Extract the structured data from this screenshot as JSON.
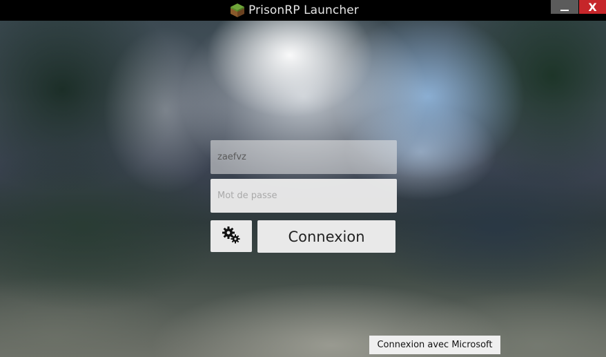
{
  "window": {
    "title": "PrisonRP Launcher",
    "app_icon": "grass-block-icon",
    "minimize_icon": "minimize-icon",
    "close_label": "X"
  },
  "login": {
    "username": {
      "value": "zaefvz",
      "placeholder": ""
    },
    "password": {
      "value": "",
      "placeholder": "Mot de passe"
    },
    "settings_icon": "gears-icon",
    "connect_label": "Connexion"
  },
  "microsoft": {
    "label": "Connexion avec Microsoft"
  },
  "colors": {
    "close_button": "#c6262a",
    "minimize_button": "#5b5b5b",
    "titlebar": "#000000",
    "button_bg": "#e9e9e9"
  }
}
